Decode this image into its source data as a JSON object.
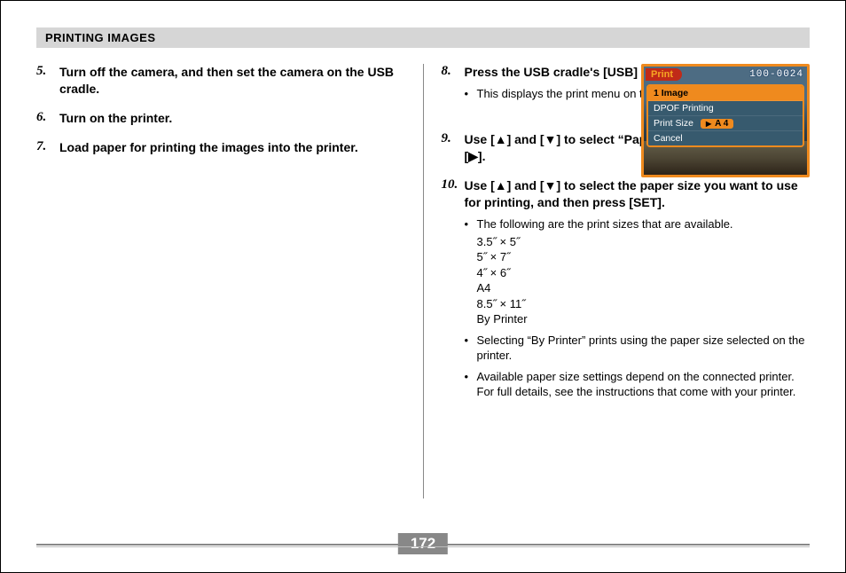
{
  "header": "PRINTING IMAGES",
  "page_number": "172",
  "left": {
    "s5": {
      "num": "5.",
      "title": "Turn off the camera, and then set the camera on the USB cradle."
    },
    "s6": {
      "num": "6.",
      "title": "Turn on the printer."
    },
    "s7": {
      "num": "7.",
      "title": "Load paper for printing the images into the printer."
    }
  },
  "right": {
    "s8": {
      "num": "8.",
      "title": "Press the USB cradle's [USB] button.",
      "bullet1": "This displays the print menu on the camera's monitor screen."
    },
    "s9": {
      "num": "9.",
      "title": "Use [▲] and [▼] to select “Paper Size”, and then press [▶]."
    },
    "s10": {
      "num": "10.",
      "title": "Use [▲] and [▼] to select the paper size you want to use for printing, and then press [SET].",
      "bullet1": "The following are the print sizes that are available.",
      "sizes": {
        "a": "3.5˝ × 5˝",
        "b": "5˝ × 7˝",
        "c": "4˝ × 6˝",
        "d": "A4",
        "e": "8.5˝ × 11˝",
        "f": "By Printer"
      },
      "bullet2": "Selecting “By Printer” prints using the paper size selected on the printer.",
      "bullet3": "Available paper size settings depend on the connected printer. For full details, see the instructions that come with your printer."
    }
  },
  "cam": {
    "top_left": "Print",
    "top_right": "100-0024",
    "row1": "1 Image",
    "row2": "DPOF Printing",
    "row3_label": "Print Size",
    "row3_value": "A 4",
    "row4": "Cancel"
  }
}
